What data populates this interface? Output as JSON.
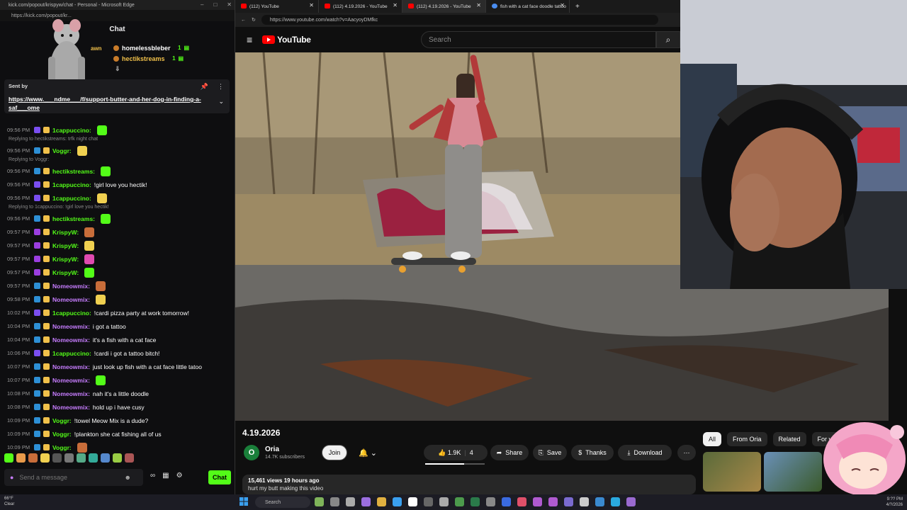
{
  "kick": {
    "window_title": "kick.com/popout/krispyw/chat - Personal - Microsoft Edge",
    "url": "https://kick.com/popout/kr...",
    "header": "Chat",
    "leaderboard": [
      {
        "name": "homelessbleber",
        "gifts": "1"
      },
      {
        "name": "hectikstreams",
        "gifts": "1"
      }
    ],
    "leaderboard_partial": "awn",
    "pinned": {
      "sent_by": "Sent by",
      "link": "https://www.___ndme___/f/support-butter-and-her-dog-in-finding-a-saf___ome"
    },
    "messages": [
      {
        "time": "09:56 PM",
        "user": "1cappuccino:",
        "text": "",
        "ucolor": "#53fc18",
        "bcolor": "#7a4ef0"
      },
      {
        "reply": "Replying to hectikstreams: trfk night chat"
      },
      {
        "time": "09:56 PM",
        "user": "Voggr:",
        "text": "",
        "ucolor": "#53fc18",
        "bcolor": "#2d8fd5"
      },
      {
        "reply": "Replying to Voggr:"
      },
      {
        "time": "09:56 PM",
        "user": "hectikstreams:",
        "text": "",
        "ucolor": "#53fc18",
        "bcolor": "#2d8fd5"
      },
      {
        "time": "09:56 PM",
        "user": "1cappuccino:",
        "text": "!girl love you hectik!",
        "ucolor": "#53fc18",
        "bcolor": "#7a4ef0"
      },
      {
        "time": "09:56 PM",
        "user": "1cappuccino:",
        "text": "",
        "ucolor": "#53fc18",
        "bcolor": "#7a4ef0"
      },
      {
        "reply": "Replying to 1cappuccino: !girl love you hectik!"
      },
      {
        "time": "09:56 PM",
        "user": "hectikstreams:",
        "text": "",
        "ucolor": "#53fc18",
        "bcolor": "#2d8fd5"
      },
      {
        "time": "09:57 PM",
        "user": "KrispyW:",
        "text": "",
        "ucolor": "#53fc18",
        "bcolor": "#9b3ee0"
      },
      {
        "time": "09:57 PM",
        "user": "KrispyW:",
        "text": "",
        "ucolor": "#53fc18",
        "bcolor": "#9b3ee0"
      },
      {
        "time": "09:57 PM",
        "user": "KrispyW:",
        "text": "",
        "ucolor": "#53fc18",
        "bcolor": "#9b3ee0"
      },
      {
        "time": "09:57 PM",
        "user": "KrispyW:",
        "text": "",
        "ucolor": "#53fc18",
        "bcolor": "#9b3ee0"
      },
      {
        "time": "09:57 PM",
        "user": "Nomeowmix:",
        "text": "",
        "ucolor": "#c77dff",
        "bcolor": "#2d8fd5"
      },
      {
        "time": "09:58 PM",
        "user": "Nomeowmix:",
        "text": "",
        "ucolor": "#c77dff",
        "bcolor": "#2d8fd5"
      },
      {
        "time": "10:02 PM",
        "user": "1cappuccino:",
        "text": "!cardi pizza party at work tomorrow!",
        "ucolor": "#53fc18",
        "bcolor": "#7a4ef0"
      },
      {
        "time": "10:04 PM",
        "user": "Nomeowmix:",
        "text": "i got a tattoo",
        "ucolor": "#c77dff",
        "bcolor": "#2d8fd5"
      },
      {
        "time": "10:04 PM",
        "user": "Nomeowmix:",
        "text": "it's a fish with a cat face",
        "ucolor": "#c77dff",
        "bcolor": "#2d8fd5"
      },
      {
        "time": "10:06 PM",
        "user": "1cappuccino:",
        "text": "!cardi i got a tattoo bitch!",
        "ucolor": "#53fc18",
        "bcolor": "#7a4ef0"
      },
      {
        "time": "10:07 PM",
        "user": "Nomeowmix:",
        "text": "just look up fish with a cat face little tatoo",
        "ucolor": "#c77dff",
        "bcolor": "#2d8fd5"
      },
      {
        "time": "10:07 PM",
        "user": "Nomeowmix:",
        "text": "",
        "ucolor": "#c77dff",
        "bcolor": "#2d8fd5"
      },
      {
        "time": "10:08 PM",
        "user": "Nomeowmix:",
        "text": "nah it's a little doodle",
        "ucolor": "#c77dff",
        "bcolor": "#2d8fd5"
      },
      {
        "time": "10:08 PM",
        "user": "Nomeowmix:",
        "text": "hold up i have cusy",
        "ucolor": "#c77dff",
        "bcolor": "#2d8fd5"
      },
      {
        "time": "10:09 PM",
        "user": "Voggr:",
        "text": "!towel Meow Mix is a dude?",
        "ucolor": "#53fc18",
        "bcolor": "#2d8fd5"
      },
      {
        "time": "10:09 PM",
        "user": "Voggr:",
        "text": "!plankton she cat fishing all of us",
        "ucolor": "#53fc18",
        "bcolor": "#2d8fd5"
      },
      {
        "time": "10:09 PM",
        "user": "Voggr:",
        "text": "",
        "ucolor": "#53fc18",
        "bcolor": "#2d8fd5"
      }
    ],
    "input_placeholder": "Send a message",
    "send_label": "Chat"
  },
  "browser": {
    "tabs": [
      {
        "label": "(112) YouTube"
      },
      {
        "label": "(112) 4.19.2026 - YouTube"
      },
      {
        "label": "(112) 4.19.2026 - YouTube"
      },
      {
        "label": "fish with a cat face doodle tattoo"
      }
    ],
    "url": "https://www.youtube.com/watch?v=AacyoyDMfkc"
  },
  "youtube": {
    "logo": "YouTube",
    "search_placeholder": "Search",
    "video_title": "4.19.2026",
    "channel_initial": "O",
    "channel": "Oria",
    "subs": "14.7K subscribers",
    "join": "Join",
    "likes": "1.9K",
    "dislikes": "4",
    "like_ratio": 0.66,
    "share": "Share",
    "save": "Save",
    "thanks": "Thanks",
    "download": "Download",
    "views": "15,461 views  19 hours ago",
    "desc_line": "hurt my butt making this video",
    "chips": [
      "All",
      "From Oria",
      "Related",
      "For you"
    ]
  },
  "taskbar": {
    "weather_temp": "66°F",
    "weather_desc": "Clear",
    "search": "Search",
    "time": "9:?? PM",
    "date": "4/?/2026"
  }
}
